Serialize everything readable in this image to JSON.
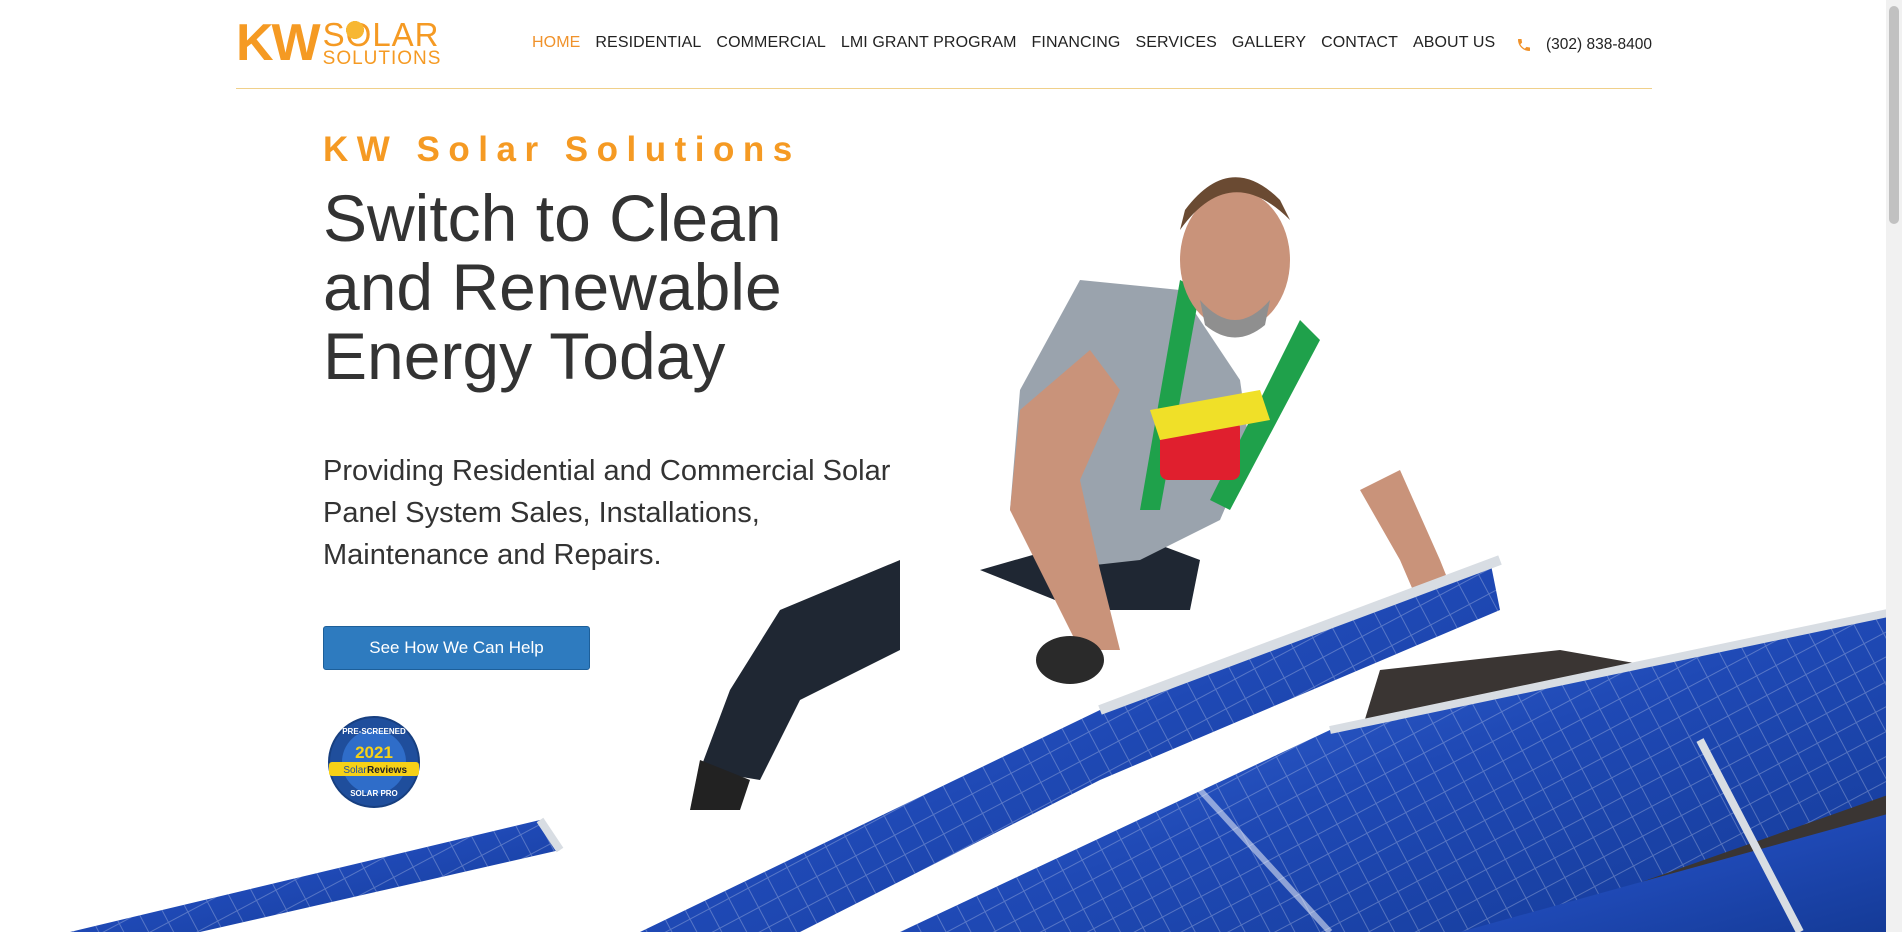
{
  "logo": {
    "kw": "KW",
    "solar": "SOLAR",
    "solutions": "SOLUTIONS"
  },
  "nav": [
    {
      "label": "HOME",
      "active": true
    },
    {
      "label": "RESIDENTIAL"
    },
    {
      "label": "COMMERCIAL"
    },
    {
      "label": "LMI GRANT PROGRAM"
    },
    {
      "label": "FINANCING"
    },
    {
      "label": "SERVICES"
    },
    {
      "label": "GALLERY"
    },
    {
      "label": "CONTACT"
    },
    {
      "label": "ABOUT US"
    }
  ],
  "phone": {
    "icon": "phone-icon",
    "number": "(302) 838-8400"
  },
  "hero": {
    "eyebrow": "KW Solar Solutions",
    "headline_line1": "Switch to Clean",
    "headline_line2": "and Renewable",
    "headline_line3": "Energy Today",
    "sub_line1": "Providing Residential and Commercial Solar",
    "sub_line2": "Panel System Sales, Installations,",
    "sub_line3": "Maintenance and Repairs.",
    "cta": "See How We Can Help"
  },
  "badge": {
    "top": "PRE-SCREENED",
    "year": "2021",
    "brand_a": "Solar",
    "brand_b": "Reviews",
    "bottom": "SOLAR PRO"
  },
  "colors": {
    "accent": "#f59a23",
    "button": "#2e7bbf",
    "text": "#333333",
    "panel": "#2a55c8"
  }
}
